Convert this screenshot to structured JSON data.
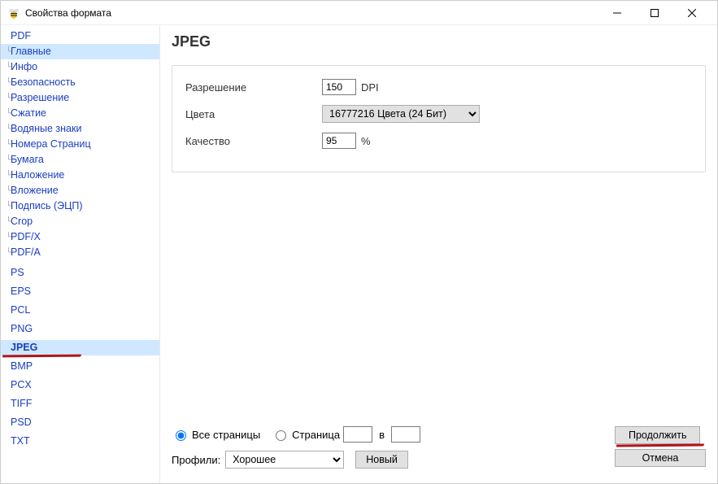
{
  "window": {
    "title": "Свойства формата"
  },
  "sidebar": {
    "pdf": {
      "label": "PDF",
      "children": [
        {
          "id": "main",
          "label": "Главные",
          "selected": true
        },
        {
          "id": "info",
          "label": "Инфо"
        },
        {
          "id": "security",
          "label": "Безопасность"
        },
        {
          "id": "resolution",
          "label": "Разрешение"
        },
        {
          "id": "compression",
          "label": "Сжатие"
        },
        {
          "id": "watermarks",
          "label": "Водяные знаки"
        },
        {
          "id": "pagenums",
          "label": "Номера Страниц"
        },
        {
          "id": "paper",
          "label": "Бумага"
        },
        {
          "id": "overlay",
          "label": "Наложение"
        },
        {
          "id": "attachment",
          "label": "Вложение"
        },
        {
          "id": "signature",
          "label": "Подпись   (ЭЦП)"
        },
        {
          "id": "crop",
          "label": "Crop"
        },
        {
          "id": "pdfx",
          "label": "PDF/X"
        },
        {
          "id": "pdfa",
          "label": "PDF/A"
        }
      ]
    },
    "formats": [
      {
        "id": "ps",
        "label": "PS"
      },
      {
        "id": "eps",
        "label": "EPS"
      },
      {
        "id": "pcl",
        "label": "PCL"
      },
      {
        "id": "png",
        "label": "PNG"
      },
      {
        "id": "jpeg",
        "label": "JPEG",
        "active": true
      },
      {
        "id": "bmp",
        "label": "BMP"
      },
      {
        "id": "pcx",
        "label": "PCX"
      },
      {
        "id": "tiff",
        "label": "TIFF"
      },
      {
        "id": "psd",
        "label": "PSD"
      },
      {
        "id": "txt",
        "label": "TXT"
      }
    ]
  },
  "main": {
    "heading": "JPEG",
    "resolution": {
      "label": "Разрешение",
      "value": "150",
      "suffix": "DPI"
    },
    "colors": {
      "label": "Цвета",
      "value": "16777216 Цвета (24 Бит)"
    },
    "quality": {
      "label": "Качество",
      "value": "95",
      "suffix": "%"
    }
  },
  "footer": {
    "pages": {
      "all_label": "Все страницы",
      "range_label": "Страница",
      "range_sep": "в",
      "from": "",
      "to": ""
    },
    "profiles": {
      "label": "Профили:",
      "value": "Хорошее",
      "new_btn": "Новый"
    },
    "continue_btn": "Продолжить",
    "cancel_btn": "Отмена"
  }
}
